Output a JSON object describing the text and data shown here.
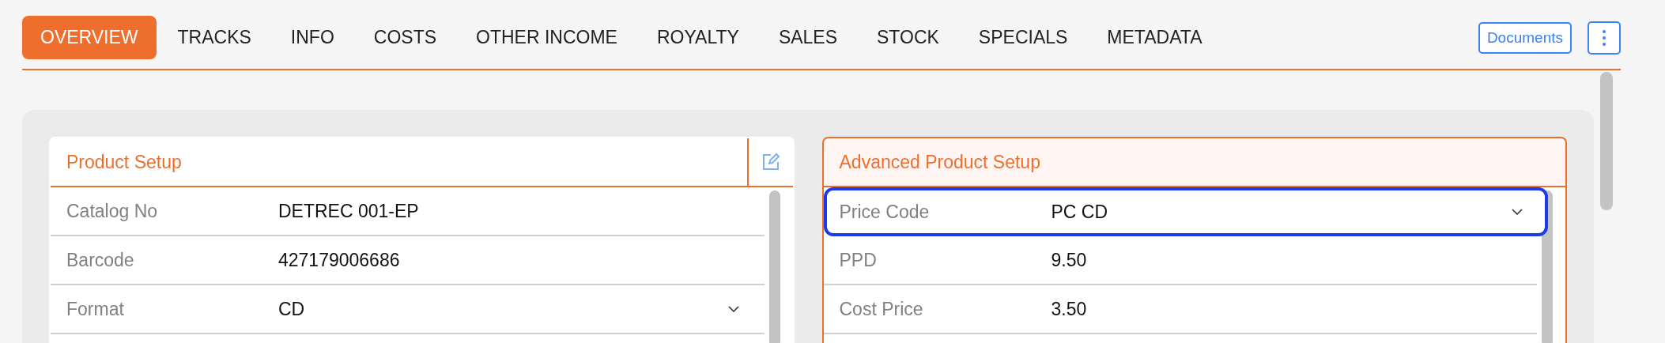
{
  "tabs": [
    {
      "label": "OVERVIEW",
      "selected": true
    },
    {
      "label": "TRACKS",
      "selected": false
    },
    {
      "label": "INFO",
      "selected": false
    },
    {
      "label": "COSTS",
      "selected": false
    },
    {
      "label": "OTHER INCOME",
      "selected": false
    },
    {
      "label": "ROYALTY",
      "selected": false
    },
    {
      "label": "SALES",
      "selected": false
    },
    {
      "label": "STOCK",
      "selected": false
    },
    {
      "label": "SPECIALS",
      "selected": false
    },
    {
      "label": "METADATA",
      "selected": false
    }
  ],
  "documents_button": "Documents",
  "cards": [
    {
      "title": "Product Setup",
      "editable": true,
      "highlighted": false,
      "rows": [
        {
          "label": "Catalog No",
          "value": "DETREC 001-EP",
          "kind": "text",
          "focused": false
        },
        {
          "label": "Barcode",
          "value": "427179006686",
          "kind": "text",
          "focused": false
        },
        {
          "label": "Format",
          "value": "CD",
          "kind": "select",
          "focused": false
        }
      ]
    },
    {
      "title": "Advanced Product Setup",
      "editable": false,
      "highlighted": true,
      "rows": [
        {
          "label": "Price Code",
          "value": "PC CD",
          "kind": "select",
          "focused": true
        },
        {
          "label": "PPD",
          "value": "9.50",
          "kind": "text",
          "focused": false
        },
        {
          "label": "Cost Price",
          "value": "3.50",
          "kind": "text",
          "focused": false
        }
      ]
    }
  ]
}
